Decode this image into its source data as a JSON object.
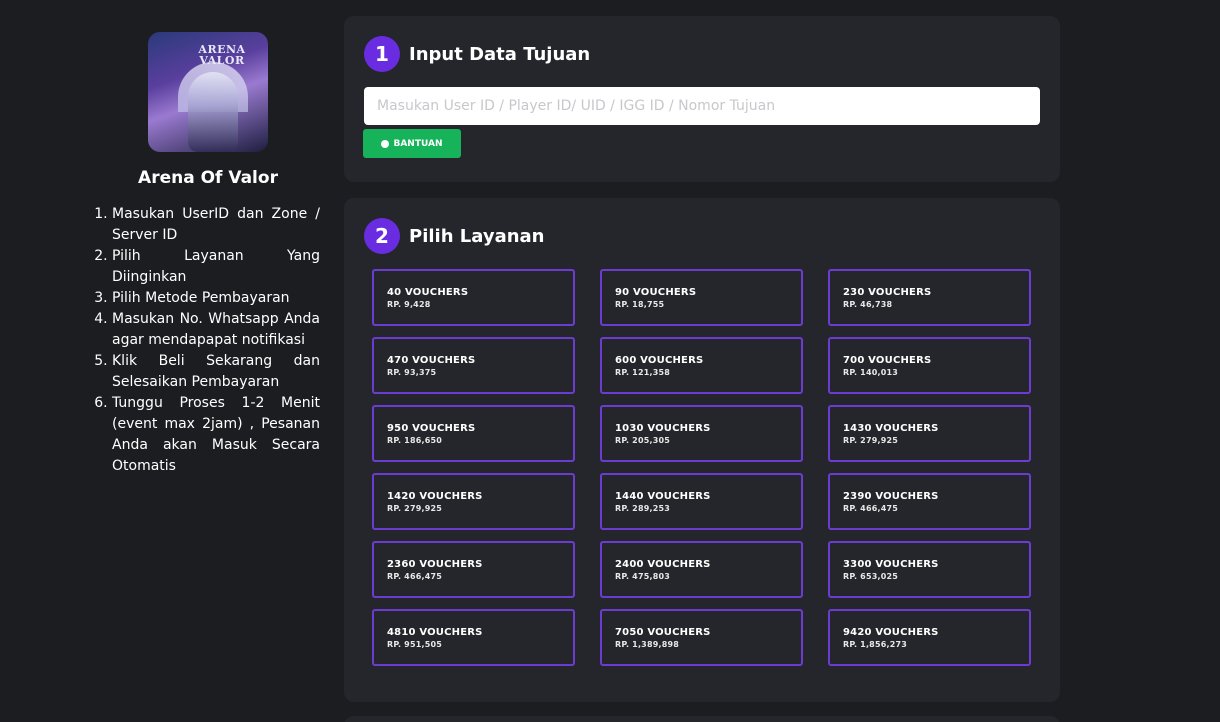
{
  "game": {
    "title": "Arena Of Valor",
    "image_logo_text": "ARENA VALOR"
  },
  "steps": [
    "Masukan UserID dan Zone / Server ID",
    "Pilih Layanan Yang Diinginkan",
    "Pilih Metode Pembayaran",
    "Masukan No. Whatsapp Anda agar mendapapat notifikasi",
    "Klik Beli Sekarang dan Selesaikan Pembayaran",
    "Tunggu Proses 1-2 Menit (event max 2jam) , Pesanan Anda akan Masuk Secara Otomatis"
  ],
  "section1": {
    "number": "1",
    "title": "Input Data Tujuan",
    "input_placeholder": "Masukan User ID / Player ID/ UID / IGG ID / Nomor Tujuan",
    "input_value": "",
    "help_label": "BANTUAN"
  },
  "section2": {
    "number": "2",
    "title": "Pilih Layanan",
    "vouchers": [
      {
        "name": "40 VOUCHERS",
        "price": "RP. 9,428"
      },
      {
        "name": "90 VOUCHERS",
        "price": "RP. 18,755"
      },
      {
        "name": "230 VOUCHERS",
        "price": "RP. 46,738"
      },
      {
        "name": "470 VOUCHERS",
        "price": "RP. 93,375"
      },
      {
        "name": "600 VOUCHERS",
        "price": "RP. 121,358"
      },
      {
        "name": "700 VOUCHERS",
        "price": "RP. 140,013"
      },
      {
        "name": "950 VOUCHERS",
        "price": "RP. 186,650"
      },
      {
        "name": "1030 VOUCHERS",
        "price": "RP. 205,305"
      },
      {
        "name": "1430 VOUCHERS",
        "price": "RP. 279,925"
      },
      {
        "name": "1420 VOUCHERS",
        "price": "RP. 279,925"
      },
      {
        "name": "1440 VOUCHERS",
        "price": "RP. 289,253"
      },
      {
        "name": "2390 VOUCHERS",
        "price": "RP. 466,475"
      },
      {
        "name": "2360 VOUCHERS",
        "price": "RP. 466,475"
      },
      {
        "name": "2400 VOUCHERS",
        "price": "RP. 475,803"
      },
      {
        "name": "3300 VOUCHERS",
        "price": "RP. 653,025"
      },
      {
        "name": "4810 VOUCHERS",
        "price": "RP. 951,505"
      },
      {
        "name": "7050 VOUCHERS",
        "price": "RP. 1,389,898"
      },
      {
        "name": "9420 VOUCHERS",
        "price": "RP. 1,856,273"
      }
    ]
  },
  "colors": {
    "background": "#1c1d21",
    "card": "#25262b",
    "accent_purple": "#6a2ce0",
    "voucher_border": "#6a3cd2",
    "help_green": "#17b35a"
  },
  "icons": {
    "help": "question-circle-icon"
  }
}
